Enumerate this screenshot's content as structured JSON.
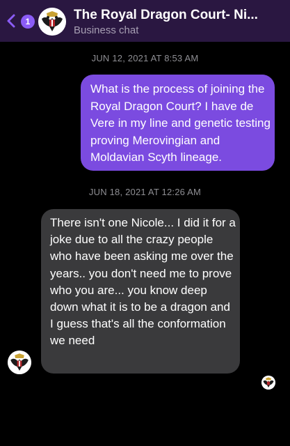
{
  "header": {
    "title": "The Royal Dragon Court- Ni...",
    "subtitle": "Business chat",
    "back_badge_count": "1",
    "back_icon": "chevron-left-icon",
    "avatar_icon": "double-headed-eagle-crest-icon"
  },
  "messages": [
    {
      "timestamp": "JUN 12, 2021 AT 8:53 AM",
      "direction": "outgoing",
      "text": "What is the process of joining the Royal Dragon Court? I have de Vere in my line and genetic testing proving Merovingian and Moldavian Scyth lineage."
    },
    {
      "timestamp": "JUN 18, 2021 AT 12:26 AM",
      "direction": "incoming",
      "text": "There isn't one Nicole... I did it for a joke due to all the crazy people who have been asking me over the years.. you don't need me to prove who you are... you know deep down what it is to be a dragon and I guess that's all the conformation we need"
    }
  ],
  "colors": {
    "header_bg": "#2a1741",
    "accent": "#8b5cf6",
    "outgoing_bubble": "#7b4be0",
    "incoming_bubble": "#3a3a3c",
    "timestamp": "#8e8e93"
  }
}
